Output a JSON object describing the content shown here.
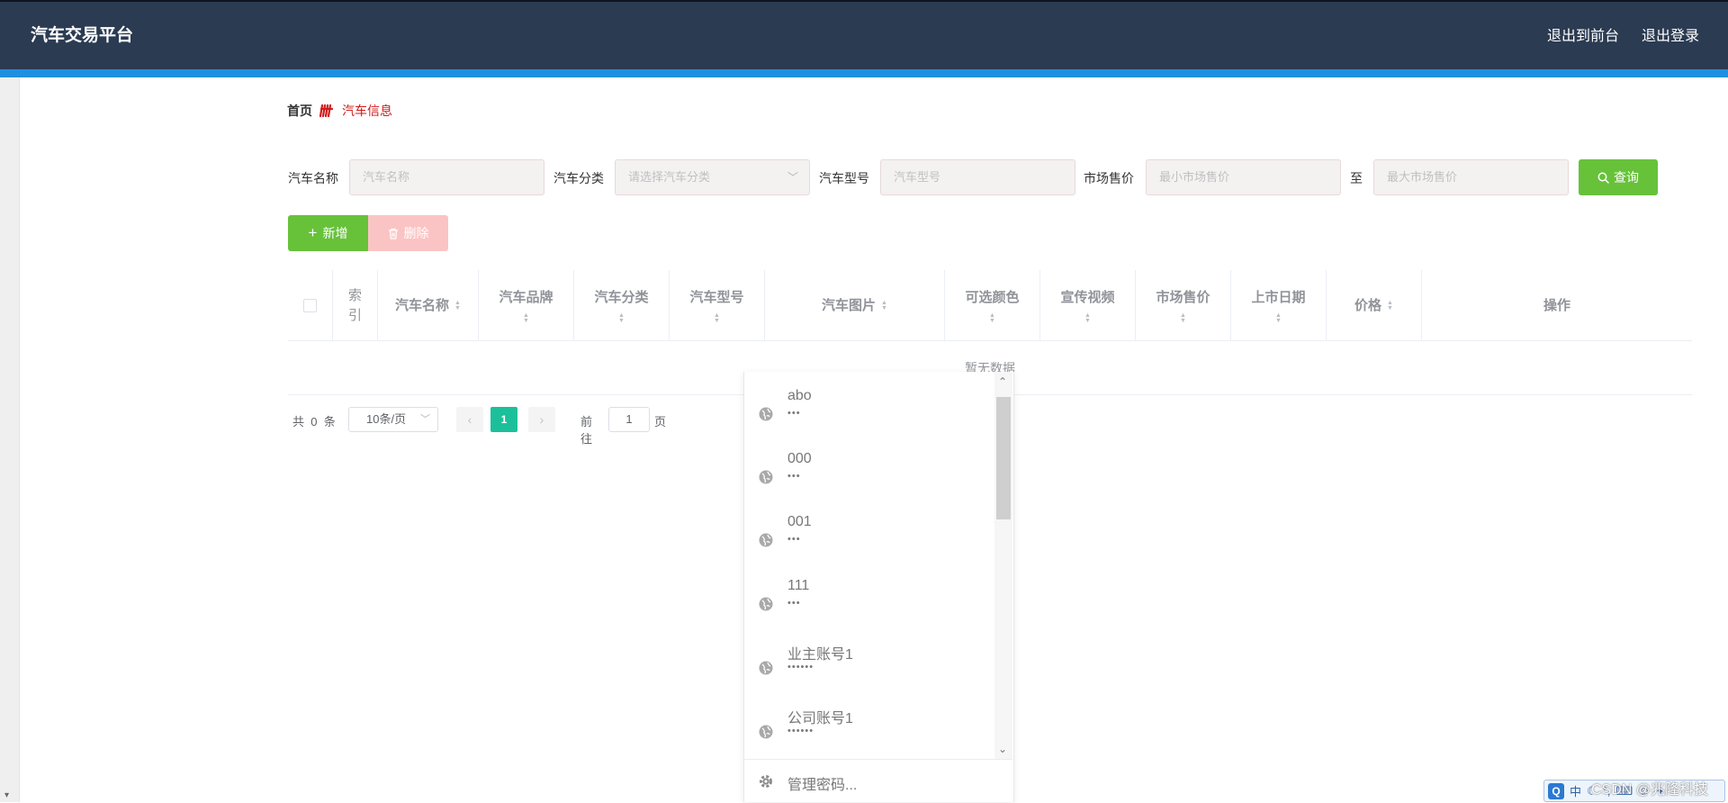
{
  "header": {
    "app_title": "汽车交易平台",
    "nav": [
      "退出到前台",
      "退出登录"
    ]
  },
  "breadcrumb": {
    "home": "首页",
    "current": "汽车信息",
    "accent_color": "#d11a1a"
  },
  "search": {
    "name_label": "汽车名称",
    "name_placeholder": "汽车名称",
    "category_label": "汽车分类",
    "category_placeholder": "请选择汽车分类",
    "model_label": "汽车型号",
    "model_placeholder": "汽车型号",
    "price_label": "市场售价",
    "price_min_placeholder": "最小市场售价",
    "price_to": "至",
    "price_max_placeholder": "最大市场售价",
    "query_button": "查询"
  },
  "actions": {
    "add_button": "新增",
    "delete_button": "删除"
  },
  "table": {
    "columns": [
      "索引",
      "汽车名称",
      "汽车品牌",
      "汽车分类",
      "汽车型号",
      "汽车图片",
      "可选颜色",
      "宣传视频",
      "市场售价",
      "上市日期",
      "价格",
      "操作"
    ],
    "empty_text": "暂无数据"
  },
  "pagination": {
    "total_prefix": "共",
    "total": "0",
    "total_suffix": "条",
    "page_size": "10条/页",
    "current_page": "1",
    "goto_prefix": "前往",
    "goto_value": "1",
    "goto_suffix": "页"
  },
  "autocomplete": {
    "items": [
      {
        "user": "abo",
        "pass": "•••"
      },
      {
        "user": "000",
        "pass": "•••"
      },
      {
        "user": "001",
        "pass": "•••"
      },
      {
        "user": "111",
        "pass": "•••"
      },
      {
        "user": "业主账号1",
        "pass": "••••••"
      },
      {
        "user": "公司账号1",
        "pass": "••••••"
      }
    ],
    "footer": "管理密码..."
  },
  "ime": {
    "logo": "Q",
    "lang": "中"
  },
  "watermark": "CSDN @兆隆科技",
  "colors": {
    "header_bg": "#2b3b52",
    "stripe": "#1f8fe0",
    "primary_green": "#67c23a",
    "danger_light": "#fbc4c4",
    "page_active": "#1bc09a"
  }
}
